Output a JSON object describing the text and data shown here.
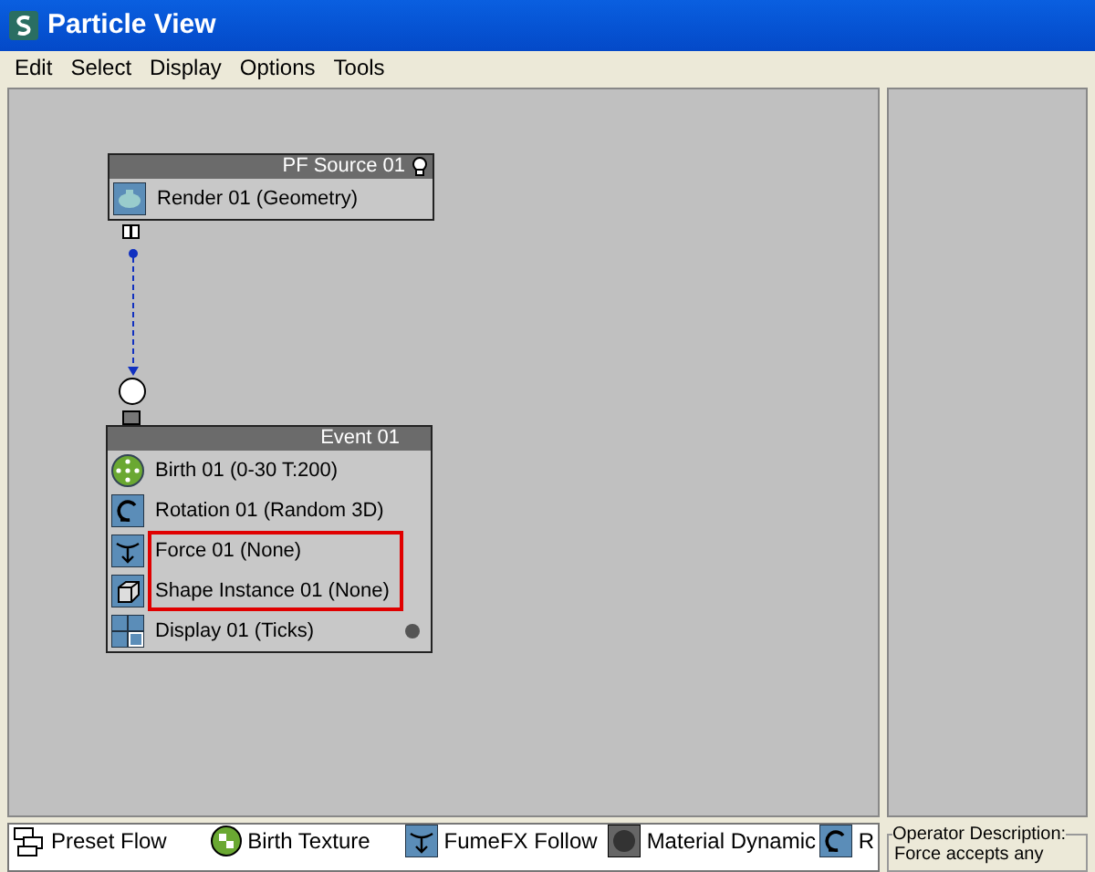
{
  "window": {
    "title": "Particle View"
  },
  "menu": [
    "Edit",
    "Select",
    "Display",
    "Options",
    "Tools"
  ],
  "nodes": [
    {
      "title": "PF Source 01",
      "kind": "global",
      "operators": [
        {
          "label": "Render 01 (Geometry)",
          "highlighted": false
        }
      ]
    },
    {
      "title": "Event 01",
      "kind": "event",
      "operators": [
        {
          "label": "Birth 01 (0-30 T:200)",
          "highlighted": false
        },
        {
          "label": "Rotation 01 (Random 3D)",
          "highlighted": false
        },
        {
          "label": "Force 01 (None)",
          "highlighted": true
        },
        {
          "label": "Shape Instance 01 (None)",
          "highlighted": true
        },
        {
          "label": "Display 01 (Ticks)",
          "highlighted": false
        }
      ]
    }
  ],
  "depot": [
    {
      "label": "Preset Flow"
    },
    {
      "label": "Birth Texture"
    },
    {
      "label": "FumeFX Follow"
    },
    {
      "label": "Material Dynamic"
    },
    {
      "label": "R"
    }
  ],
  "description": {
    "title": "Operator Description:",
    "text": "Force accepts any"
  }
}
